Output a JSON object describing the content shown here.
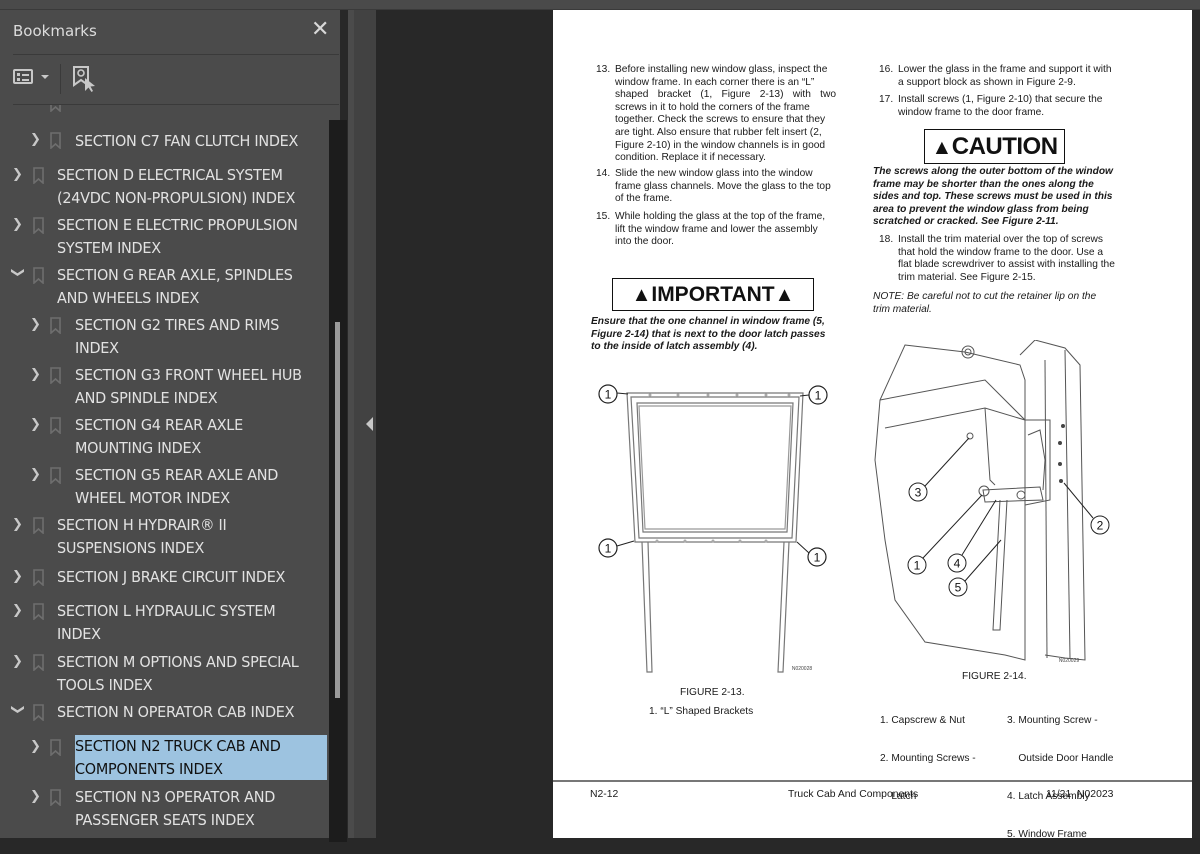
{
  "sidebar": {
    "title": "Bookmarks",
    "close_icon": "close-icon",
    "options_icon": "options-list-icon",
    "find_bookmark_icon": "find-current-bookmark-icon",
    "items": [
      {
        "label": "SECTION C7 FAN CLUTCH INDEX",
        "level": 2,
        "expanded": false,
        "selected": false
      },
      {
        "label": "SECTION D ELECTRICAL SYSTEM (24VDC NON-PROPULSION) INDEX",
        "line1": "SECTION D ELECTRICAL SYSTEM",
        "line2": "(24VDC NON-PROPULSION) INDEX",
        "level": 1,
        "expanded": false,
        "selected": false
      },
      {
        "label": "SECTION E ELECTRIC PROPULSION SYSTEM INDEX",
        "line1": "SECTION E ELECTRIC PROPULSION",
        "line2": "SYSTEM INDEX",
        "level": 1,
        "expanded": false,
        "selected": false
      },
      {
        "label": "SECTION G REAR AXLE, SPINDLES AND WHEELS INDEX",
        "line1": "SECTION G REAR AXLE, SPINDLES",
        "line2": "AND WHEELS INDEX",
        "level": 1,
        "expanded": true,
        "selected": false
      },
      {
        "label": "SECTION G2 TIRES AND RIMS INDEX",
        "line1": "SECTION G2 TIRES AND RIMS",
        "line2": "INDEX",
        "level": 2,
        "expanded": false,
        "selected": false
      },
      {
        "label": "SECTION G3 FRONT WHEEL HUB AND SPINDLE INDEX",
        "line1": "SECTION G3 FRONT WHEEL HUB",
        "line2": "AND SPINDLE INDEX",
        "level": 2,
        "expanded": false,
        "selected": false
      },
      {
        "label": "SECTION G4 REAR AXLE MOUNTING INDEX",
        "line1": "SECTION G4 REAR AXLE",
        "line2": "MOUNTING INDEX",
        "level": 2,
        "expanded": false,
        "selected": false
      },
      {
        "label": "SECTION G5 REAR AXLE AND WHEEL MOTOR INDEX",
        "line1": "SECTION G5 REAR AXLE AND",
        "line2": "WHEEL MOTOR INDEX",
        "level": 2,
        "expanded": false,
        "selected": false
      },
      {
        "label": "SECTION H HYDRAIR® II SUSPENSIONS INDEX",
        "line1": "SECTION H HYDRAIR® II",
        "line2": "SUSPENSIONS INDEX",
        "level": 1,
        "expanded": false,
        "selected": false
      },
      {
        "label": "SECTION J BRAKE CIRCUIT INDEX",
        "line1": "SECTION J BRAKE CIRCUIT INDEX",
        "level": 1,
        "expanded": false,
        "selected": false
      },
      {
        "label": "SECTION L HYDRAULIC SYSTEM INDEX",
        "line1": "SECTION L HYDRAULIC SYSTEM",
        "line2": "INDEX",
        "level": 1,
        "expanded": false,
        "selected": false
      },
      {
        "label": "SECTION M OPTIONS AND SPECIAL TOOLS INDEX",
        "line1": "SECTION M OPTIONS AND SPECIAL",
        "line2": "TOOLS INDEX",
        "level": 1,
        "expanded": false,
        "selected": false
      },
      {
        "label": "SECTION N OPERATOR CAB INDEX",
        "line1": "SECTION N OPERATOR CAB INDEX",
        "level": 1,
        "expanded": true,
        "selected": false
      },
      {
        "label": "SECTION N2 TRUCK CAB AND COMPONENTS INDEX",
        "line1": "SECTION N2 TRUCK CAB AND",
        "line2": "COMPONENTS INDEX",
        "level": 2,
        "expanded": false,
        "selected": true
      },
      {
        "label": "SECTION N3 OPERATOR AND PASSENGER SEATS INDEX",
        "line1": "SECTION N3 OPERATOR AND",
        "line2": "PASSENGER SEATS INDEX",
        "level": 2,
        "expanded": false,
        "selected": false
      }
    ],
    "scroll_position_fraction": 0.28,
    "selection_color": "#9dc3e0"
  },
  "splitter": {
    "collapse_icon": "triangle-left-icon"
  },
  "document": {
    "left_column": {
      "steps": [
        {
          "num": "13.",
          "lines": [
            "Before installing new window glass, inspect the",
            "window frame. In each corner there is an “L”",
            "shaped bracket (1, Figure 2-13) with two",
            "screws in it to hold the corners of the frame",
            "together. Check the screws to ensure that they",
            "are tight. Also ensure that rubber felt insert (2,",
            "Figure 2-10) in the window channels is in good",
            "condition. Replace it if necessary."
          ]
        },
        {
          "num": "14.",
          "lines": [
            "Slide the new window glass into the window",
            "frame glass channels. Move the glass to the top",
            "of the frame."
          ]
        },
        {
          "num": "15.",
          "lines": [
            "While holding the glass at the top of the frame,",
            "lift the window frame and lower the assembly",
            "into the door."
          ]
        }
      ],
      "important_label": "IMPORTANT",
      "important_text": [
        "Ensure that the one channel in window frame (5,",
        "Figure 2-14) that is next to the door latch passes",
        "to the inside of latch assembly (4)."
      ],
      "figure": {
        "id": "N020028",
        "caption": "FIGURE 2-13.",
        "legend": [
          "1. “L” Shaped Brackets"
        ],
        "callout_label": "1"
      }
    },
    "right_column": {
      "steps": [
        {
          "num": "16.",
          "lines": [
            "Lower the glass in the frame and support it with",
            "a support block as shown in Figure 2-9."
          ]
        },
        {
          "num": "17.",
          "lines": [
            "Install screws (1, Figure 2-10) that secure the",
            "window frame to the door frame."
          ]
        }
      ],
      "caution_label": "CAUTION",
      "caution_text": [
        "The screws along the outer bottom of the window",
        "frame may be shorter than the ones along the",
        "sides and top. These screws must be used in this",
        "area to prevent the window glass from being",
        "scratched or cracked. See Figure 2-11."
      ],
      "step18": {
        "num": "18.",
        "lines": [
          "Install the trim material over the top of screws",
          "that hold the window frame to the door. Use a",
          "flat blade screwdriver to assist with installing the",
          "trim material. See Figure 2-15."
        ]
      },
      "note": [
        "NOTE: Be careful not to cut the retainer lip on the",
        "trim material."
      ],
      "figure": {
        "id": "N020029",
        "caption": "FIGURE 2-14.",
        "callouts": [
          "1",
          "2",
          "3",
          "4",
          "5"
        ],
        "legend_left": [
          "1. Capscrew & Nut",
          "2. Mounting Screws -",
          "    Latch"
        ],
        "legend_right": [
          "3. Mounting Screw -",
          "    Outside Door Handle",
          "4. Latch Assembly",
          "5. Window Frame"
        ]
      }
    },
    "footer": {
      "page_number": "N2-12",
      "section_title": "Truck Cab And Components",
      "revision": "11/21  N02023"
    }
  }
}
